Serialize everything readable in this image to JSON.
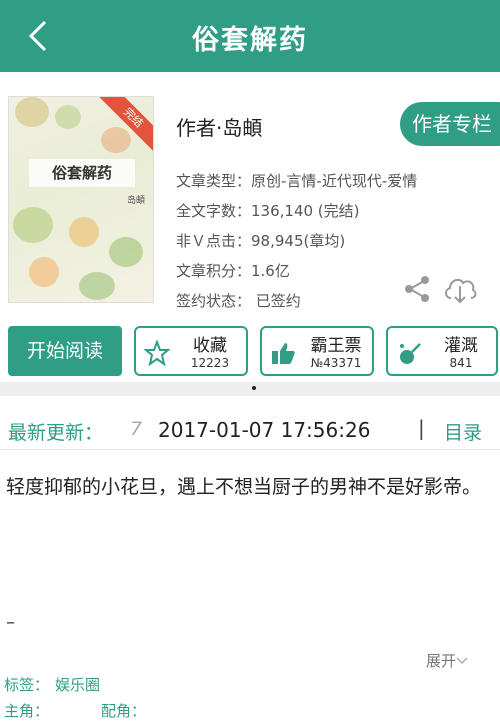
{
  "header": {
    "back_icon": "chevron-left-icon",
    "title": "俗套解药"
  },
  "book": {
    "cover": {
      "title": "俗套解药",
      "author": "岛頔",
      "badge": "完结"
    },
    "author_line": "作者·岛頔",
    "author_column_button": "作者专栏",
    "meta": [
      "文章类型：原创-言情-近代现代-爱情",
      "全文字数：136,140 (完结)",
      "非Ｖ点击：98,945(章均)",
      "文章积分：1.6亿",
      "签约状态：  已签约"
    ]
  },
  "actions": {
    "read_label": "开始阅读",
    "collect": {
      "label": "收藏",
      "count": "12223",
      "icon": "star-icon"
    },
    "vote": {
      "label": "霸王票",
      "count": "№43371",
      "icon": "thumbs-up-icon"
    },
    "water": {
      "label": "灌溉",
      "count": "841",
      "icon": "watering-can-icon"
    },
    "share_icon": "share-icon",
    "download_icon": "cloud-download-icon"
  },
  "update": {
    "label": "最新更新：",
    "prefix": "7",
    "time": "2017-01-07 17:56:26",
    "separator": "|",
    "toc_label": "目录"
  },
  "summary": {
    "text": "轻度抑郁的小花旦，遇上不想当厨子的男神不是好影帝。",
    "dash": "–",
    "expand_label": "展开"
  },
  "tags": {
    "label": "标签：",
    "value": "娱乐圈"
  },
  "roles": {
    "lead_label": "主角：",
    "support_label": "配角："
  },
  "colors": {
    "accent": "#2f9e85",
    "badge": "#e2543c"
  }
}
